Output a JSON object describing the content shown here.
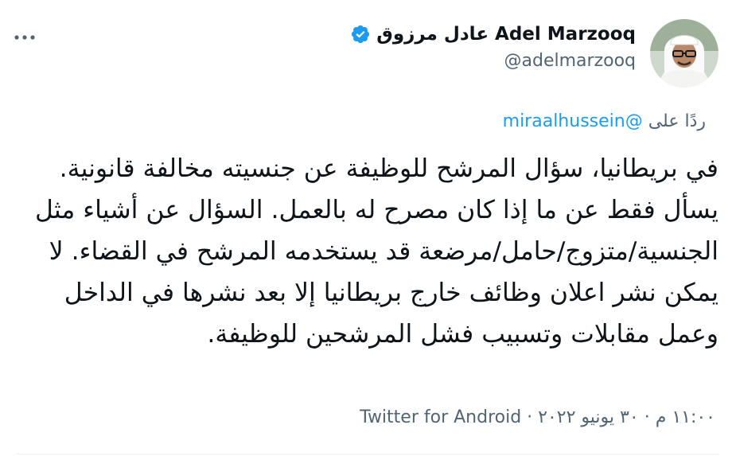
{
  "tweet": {
    "author": {
      "display_name": "عادل مرزوق Adel Marzooq",
      "handle": "@adelmarzooq",
      "verified": true,
      "avatar_icon": "user-avatar"
    },
    "more_icon": "more-horizontal-icon",
    "reply_context": {
      "prefix": "ردًا على",
      "mention": "@miraalhussein"
    },
    "text": "في بريطانيا، سؤال المرشح للوظيفة عن جنسيته مخالفة قانونية. يسأل فقط عن ما إذا كان مصرح له بالعمل. السؤال عن أشياء مثل الجنسية/متزوج/حامل/مرضعة قد يستخدمه المرشح في القضاء. لا يمكن نشر اعلان وظائف خارج بريطانيا إلا بعد نشرها في الداخل وعمل مقابلات وتسبيب فشل المرشحين للوظيفة.",
    "meta": {
      "time": "١١:٠٠ م",
      "separator": "·",
      "date": "٣٠ يونيو ٢٠٢٢",
      "source": "Twitter for Android"
    },
    "colors": {
      "accent": "#1d9bf0",
      "text": "#0f1419",
      "secondary": "#536471",
      "divider": "#eff3f4"
    }
  }
}
